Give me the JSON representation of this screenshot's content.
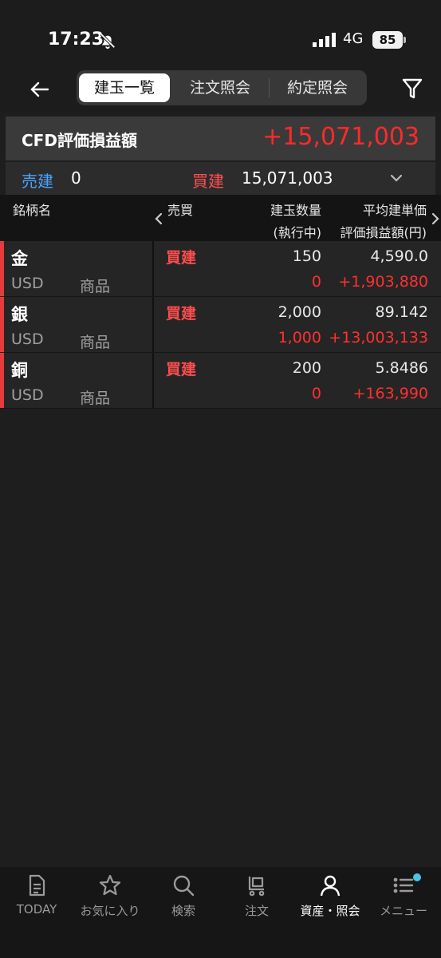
{
  "status_bar": {
    "time": "17:23",
    "network": "4G",
    "battery": "85"
  },
  "nav": {
    "tabs": [
      {
        "label": "建玉一覧",
        "active": true
      },
      {
        "label": "注文照会",
        "active": false
      },
      {
        "label": "約定照会",
        "active": false
      }
    ]
  },
  "summary": {
    "label": "CFD評価損益額",
    "value": "+15,071,003"
  },
  "breakdown": {
    "sell_label": "売建",
    "sell_value": "0",
    "buy_label": "買建",
    "buy_value": "15,071,003"
  },
  "columns": {
    "name": "銘柄名",
    "side": "売買",
    "qty": "建玉数量",
    "exec": "(執行中)",
    "avg": "平均建単価",
    "pl": "評価損益額(円)"
  },
  "positions": [
    {
      "name": "金",
      "currency": "USD",
      "category": "商品",
      "side": "買建",
      "qty": "150",
      "exec": "0",
      "avg": "4,590.0",
      "pl": "+1,903,880"
    },
    {
      "name": "銀",
      "currency": "USD",
      "category": "商品",
      "side": "買建",
      "qty": "2,000",
      "exec": "1,000",
      "avg": "89.142",
      "pl": "+13,003,133"
    },
    {
      "name": "銅",
      "currency": "USD",
      "category": "商品",
      "side": "買建",
      "qty": "200",
      "exec": "0",
      "avg": "5.8486",
      "pl": "+163,990"
    }
  ],
  "tab_bar": [
    {
      "label": "TODAY",
      "icon": "document-icon"
    },
    {
      "label": "お気に入り",
      "icon": "star-icon"
    },
    {
      "label": "検索",
      "icon": "search-icon"
    },
    {
      "label": "注文",
      "icon": "cart-icon"
    },
    {
      "label": "資産・照会",
      "icon": "person-icon",
      "active": true
    },
    {
      "label": "メニュー",
      "icon": "menu-icon"
    }
  ],
  "colors": {
    "profit": "#ff2a2a",
    "sell": "#4aa3ff",
    "buy": "#ff4d4d",
    "accent": "#e83a3a"
  }
}
